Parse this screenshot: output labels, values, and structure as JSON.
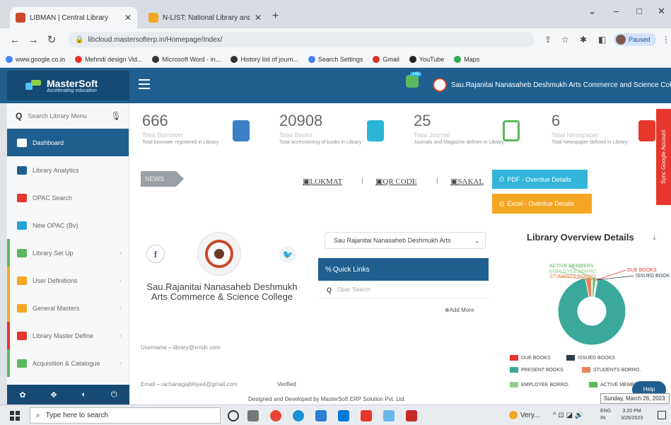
{
  "browser": {
    "tabs": [
      {
        "title": "LIBMAN | Central Library",
        "active": true
      },
      {
        "title": "N-LIST: National Library and Inf...",
        "active": false
      }
    ],
    "url": "libcloud.mastersofterp.in/Homepage/Index/",
    "profile_status": "Paused",
    "bookmarks": [
      "www.google.co.in",
      "Mehndi design Vid...",
      "Microsoft Word - in...",
      "History list of journ...",
      "Search Settings",
      "Gmail",
      "YouTube",
      "Maps"
    ]
  },
  "header": {
    "logo_name": "MasterSoft",
    "logo_tagline": "Accelerating education",
    "notification_count": "145",
    "college_name": "Sau.Rajanitai Nanasaheb Deshmukh Arts Commerce and Science College"
  },
  "sidebar": {
    "search_placeholder": "Search Library Menu",
    "items": [
      {
        "label": "Dashboard",
        "icon": "home-icon",
        "color": "#1f5f8f"
      },
      {
        "label": "Library Analytics",
        "icon": "bar-chart-icon",
        "color": "#1f5f8f"
      },
      {
        "label": "OPAC Search",
        "icon": "search-icon",
        "color": "#e5372b"
      },
      {
        "label": "New OPAC (Bv)",
        "icon": "globe-icon",
        "color": "#29a3d6"
      },
      {
        "label": "Library Set Up",
        "icon": "cogs-icon",
        "color": "#5cb85c"
      },
      {
        "label": "User Definitions",
        "icon": "users-icon",
        "color": "#f5a623"
      },
      {
        "label": "General Masters",
        "icon": "edit-icon",
        "color": "#f5a623"
      },
      {
        "label": "Library Master Define",
        "icon": "sitemap-icon",
        "color": "#e5372b"
      },
      {
        "label": "Acquisition & Catalogue",
        "icon": "book-icon",
        "color": "#5cb85c"
      }
    ]
  },
  "stats": [
    {
      "value": "666",
      "label": "Total Borrower",
      "desc": "Total borrower registered in Library",
      "icon": "user-icon",
      "color": "#3b7fc4"
    },
    {
      "value": "20908",
      "label": "Total Books",
      "desc": "Total accessioning of books in Library",
      "icon": "book-icon",
      "color": "#29b6d6"
    },
    {
      "value": "25",
      "label": "Total Journal",
      "desc": "Journals and Magazine defines in Library",
      "icon": "copy-icon",
      "color": "#5cb85c"
    },
    {
      "value": "6",
      "label": "Total Newspaper",
      "desc": "Total Newspaper defined in Library",
      "icon": "newspaper-icon",
      "color": "#e5372b"
    }
  ],
  "news": {
    "label": "NEWS",
    "items": [
      "LOKMAT",
      "QR CODE",
      "SAKAL"
    ]
  },
  "buttons": {
    "pdf": "PDF - Overdue Details",
    "excel": "Excel - Overdue Details"
  },
  "sync_tab": "Sync Google Account",
  "college_card": {
    "name": "Sau.Rajanitai Nanasaheb Deshmukh Arts Commerce & Science College",
    "username_label": "Username",
    "username": "library@srndc.com",
    "email_label": "Email",
    "email": "rachanagajbhiye4@gmail.com",
    "verified": "Verified"
  },
  "quick_links": {
    "college_select": "Sau Rajanitai Nanasaheb Deshmukh Arts",
    "title": "Quick Links",
    "search_placeholder": "Opac Search",
    "add_more": "Add More"
  },
  "chart_data": {
    "type": "pie",
    "title": "Library Overview Details",
    "donut": true,
    "series": [
      {
        "name": "DUE BOOKS",
        "value": 0.5,
        "color": "#e5372b"
      },
      {
        "name": "ISSUED BOOKS",
        "value": 0.5,
        "color": "#2c3e50"
      },
      {
        "name": "PRESENT BOOKS",
        "value": 94,
        "color": "#3aa89b"
      },
      {
        "name": "STUDENTS BORRO.",
        "value": 3,
        "color": "#e8845c"
      },
      {
        "name": "EMPLOYEE BORRO.",
        "value": 0.5,
        "color": "#8fd18a"
      },
      {
        "name": "ACTIVE MEMBERS",
        "value": 1.5,
        "color": "#5cb85c"
      }
    ],
    "callout_labels": [
      "ACTIVE MEMBERS",
      "EMPLOYEE BORRO.",
      "STUDENTS BORRO.",
      "DUE BOOKS",
      "ISSUED BOOKS"
    ],
    "legend_placement": "bottom"
  },
  "footer": {
    "text": "Designed and Developed by MasterSoft ERP Solution Pvt. Ltd.",
    "help": "Help"
  },
  "taskbar": {
    "search_placeholder": "Type here to search",
    "weather": "Very...",
    "lang_top": "ENG",
    "lang_bottom": "IN",
    "time": "3:20 PM",
    "date": "3/26/2023",
    "clock_tooltip": "Sunday, March 26, 2023"
  }
}
